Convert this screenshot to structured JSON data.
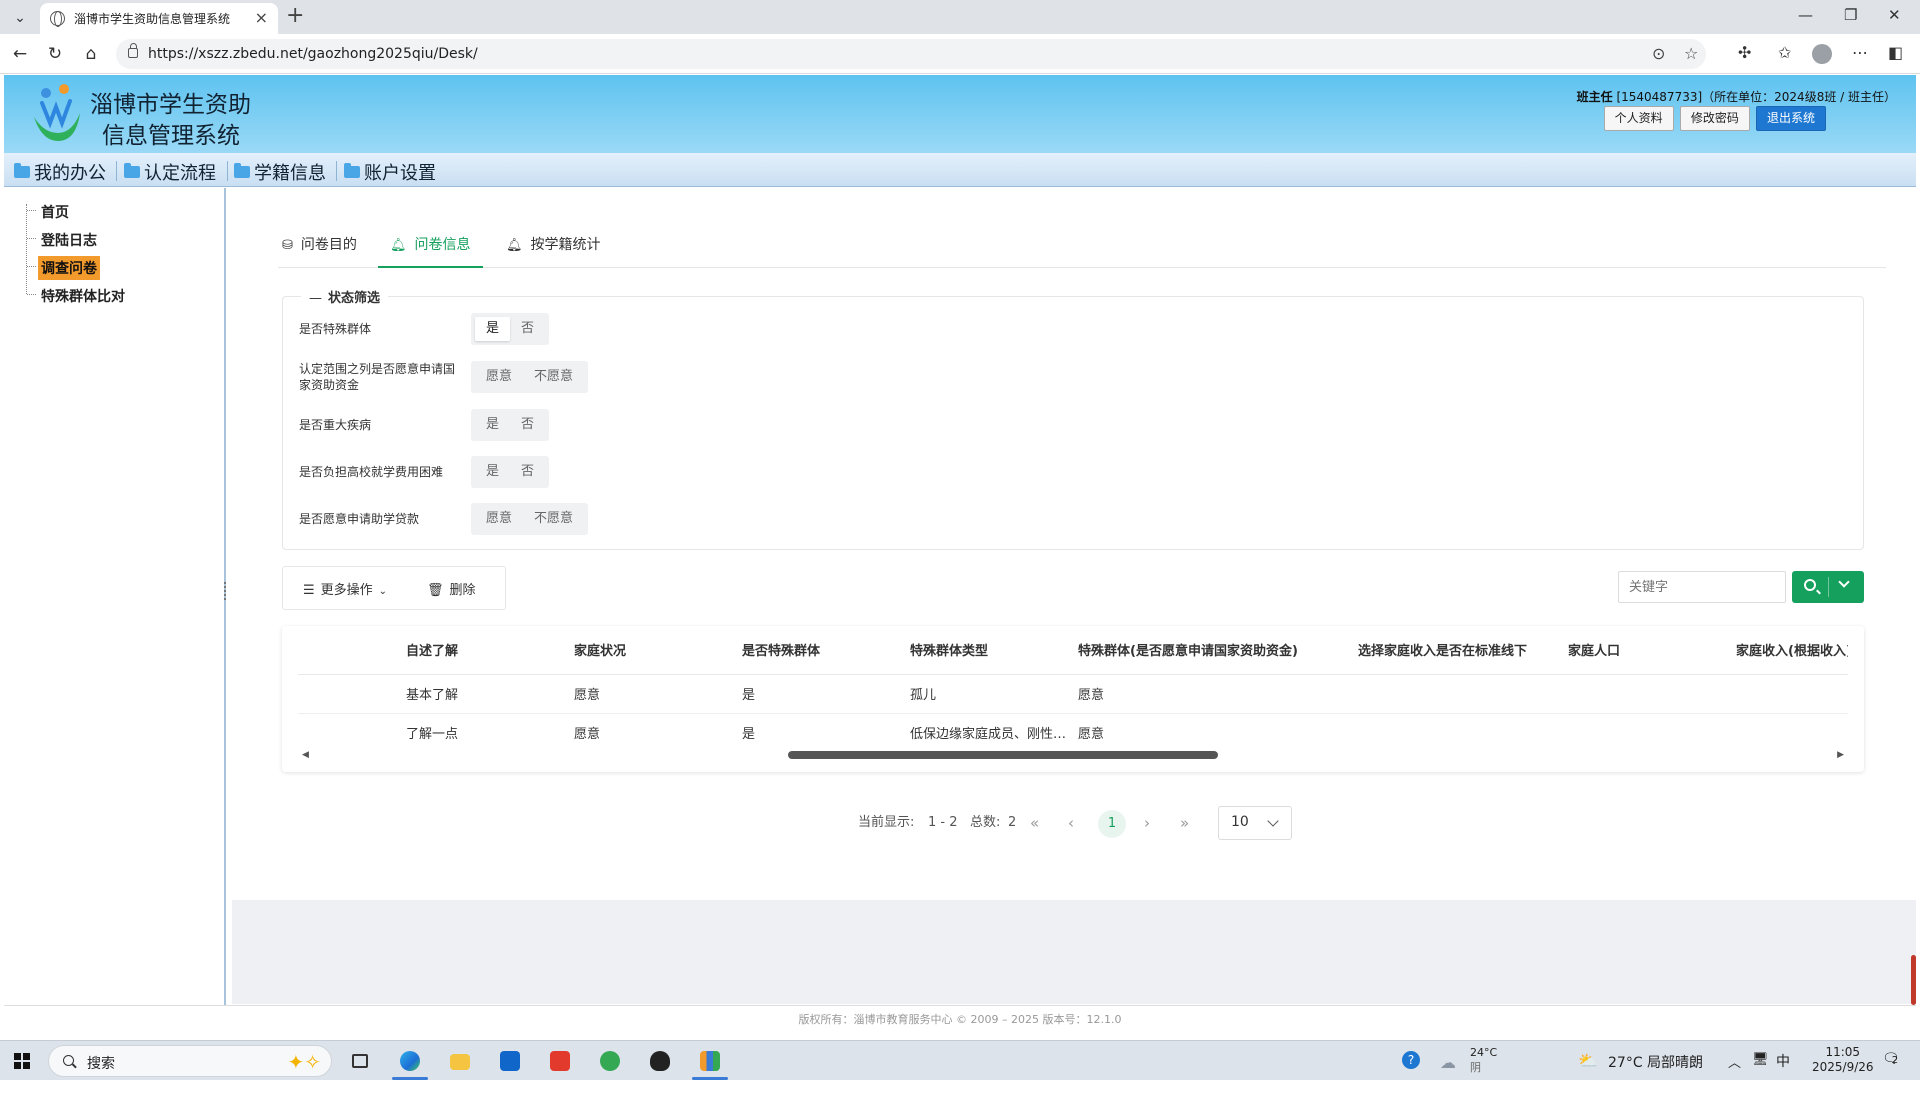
{
  "browser": {
    "tab_title": "淄博市学生资助信息管理系统",
    "url": "https://xszz.zbedu.net/gaozhong2025qiu/Desk/"
  },
  "header": {
    "title_line1": "淄博市学生资助",
    "title_line2": "信息管理系统",
    "user_role": "班主任",
    "user_info": " [1540487733]（所在单位：2024级8班 / 班主任）",
    "buttons": {
      "profile": "个人资料",
      "change_password": "修改密码",
      "logout": "退出系统"
    }
  },
  "mainnav": [
    "我的办公",
    "认定流程",
    "学籍信息",
    "账户设置"
  ],
  "sidebar": {
    "items": [
      "首页",
      "登陆日志",
      "调查问卷",
      "特殊群体比对"
    ],
    "active_index": 2
  },
  "content_tabs": [
    "问卷目的",
    "问卷信息",
    "按学籍统计"
  ],
  "active_tab": 1,
  "filter": {
    "legend": "状态筛选",
    "rows": [
      {
        "label": "是否特殊群体",
        "options": [
          "是",
          "否"
        ],
        "selected": 0
      },
      {
        "label": "认定范围之列是否愿意申请国家资助资金",
        "options": [
          "愿意",
          "不愿意"
        ],
        "selected": -1
      },
      {
        "label": "是否重大疾病",
        "options": [
          "是",
          "否"
        ],
        "selected": -1
      },
      {
        "label": "是否负担高校就学费用困难",
        "options": [
          "是",
          "否"
        ],
        "selected": -1
      },
      {
        "label": "是否愿意申请助学贷款",
        "options": [
          "愿意",
          "不愿意"
        ],
        "selected": -1
      }
    ]
  },
  "toolbar": {
    "more_ops": "更多操作",
    "delete": "删除"
  },
  "search": {
    "placeholder": "关键字"
  },
  "table": {
    "columns": [
      "",
      "自述了解",
      "家庭状况",
      "是否特殊群体",
      "特殊群体类型",
      "特殊群体(是否愿意申请国家资助资金)",
      "选择家庭收入是否在标准线下",
      "家庭人口",
      "家庭收入(根据收入)"
    ],
    "rows": [
      [
        "",
        "基本了解",
        "愿意",
        "是",
        "孤儿",
        "愿意",
        "",
        "",
        ""
      ],
      [
        "",
        "了解一点",
        "愿意",
        "是",
        "低保边缘家庭成员、刚性支出困难家庭成员",
        "愿意",
        "",
        "",
        ""
      ]
    ]
  },
  "pager": {
    "display_label": "当前显示:",
    "range": "1 - 2",
    "total_label": "总数:",
    "total": "2",
    "current_page": "1",
    "page_size": "10"
  },
  "footer": "版权所有：淄博市教育服务中心 © 2009 – 2025  版本号：12.1.0",
  "taskbar": {
    "search_text": "搜索",
    "weather_temp": "24°C",
    "weather_desc": "阴",
    "weather2": "27°C  局部晴朗",
    "ime": "中",
    "time": "11:05",
    "date": "2025/9/26",
    "notif_count": "2"
  }
}
